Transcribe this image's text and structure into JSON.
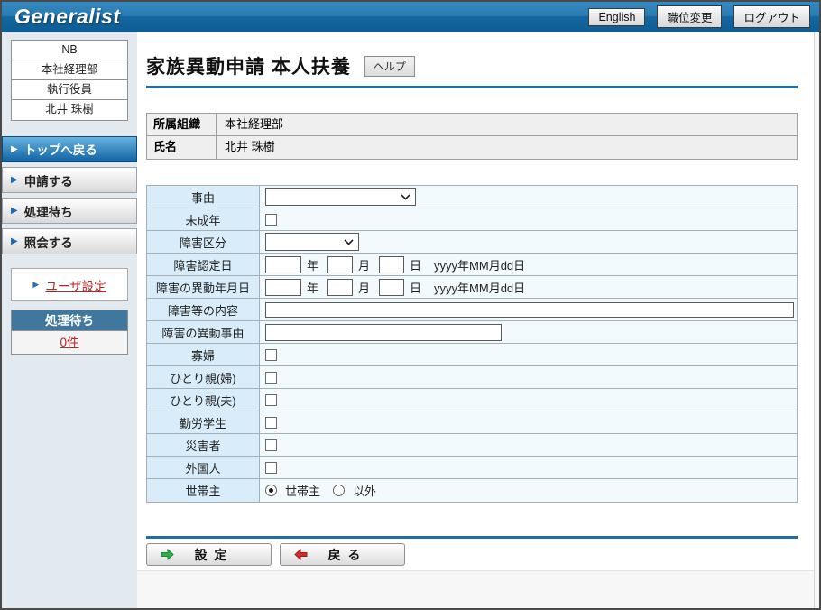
{
  "header": {
    "logo": "Generalist",
    "lang_button": "English",
    "position_button": "職位変更",
    "logout_button": "ログアウト"
  },
  "sidebar": {
    "profile": {
      "rows": [
        "NB",
        "本社経理部",
        "執行役員",
        "北井 珠樹"
      ]
    },
    "nav": {
      "items": [
        {
          "label": "トップへ戻る",
          "active": true
        },
        {
          "label": "申請する",
          "active": false
        },
        {
          "label": "処理待ち",
          "active": false
        },
        {
          "label": "照会する",
          "active": false
        }
      ]
    },
    "user_settings": {
      "label": "ユーザ設定"
    },
    "pending": {
      "title": "処理待ち",
      "count": "0件"
    }
  },
  "main": {
    "title": "家族異動申請 本人扶養",
    "help_button": "ヘルプ",
    "profile_table": {
      "rows": [
        {
          "label": "所属組織",
          "value": "本社経理部"
        },
        {
          "label": "氏名",
          "value": "北井 珠樹"
        }
      ]
    },
    "form": {
      "rows": [
        {
          "label": "事由",
          "type": "select",
          "value": ""
        },
        {
          "label": "未成年",
          "type": "checkbox",
          "checked": false
        },
        {
          "label": "障害区分",
          "type": "select",
          "value": ""
        },
        {
          "label": "障害認定日",
          "type": "date",
          "year": "",
          "month": "",
          "day": ""
        },
        {
          "label": "障害の異動年月日",
          "type": "date",
          "year": "",
          "month": "",
          "day": ""
        },
        {
          "label": "障害等の内容",
          "type": "text",
          "value": ""
        },
        {
          "label": "障害の異動事由",
          "type": "text",
          "value": ""
        },
        {
          "label": "寡婦",
          "type": "checkbox",
          "checked": false
        },
        {
          "label": "ひとり親(婦)",
          "type": "checkbox",
          "checked": false
        },
        {
          "label": "ひとり親(夫)",
          "type": "checkbox",
          "checked": false
        },
        {
          "label": "勤労学生",
          "type": "checkbox",
          "checked": false
        },
        {
          "label": "災害者",
          "type": "checkbox",
          "checked": false
        },
        {
          "label": "外国人",
          "type": "checkbox",
          "checked": false
        },
        {
          "label": "世帯主",
          "type": "radio"
        }
      ],
      "units": {
        "year": "年",
        "month": "月",
        "day": "日"
      },
      "date_hint": "yyyy年MM月dd日",
      "radio_options": [
        {
          "label": "世帯主",
          "selected": true
        },
        {
          "label": "以外",
          "selected": false
        }
      ]
    },
    "actions": {
      "set_button": "設 定",
      "back_button": "戻 る"
    }
  },
  "colors": {
    "header_blue_top": "#3489c0",
    "header_blue_bottom": "#0e5d95",
    "accent_rule_blue": "#1e6ea9",
    "active_nav_blue": "#1566a4",
    "pending_header_blue": "#40779e",
    "sidebar_bg": "#e2e9ef",
    "form_label_bg": "#d8edf9",
    "form_value_bg": "#f3fafd",
    "link_red": "#b22525",
    "set_arrow_green": "#2fae4a",
    "back_arrow_red": "#d22d2d"
  }
}
